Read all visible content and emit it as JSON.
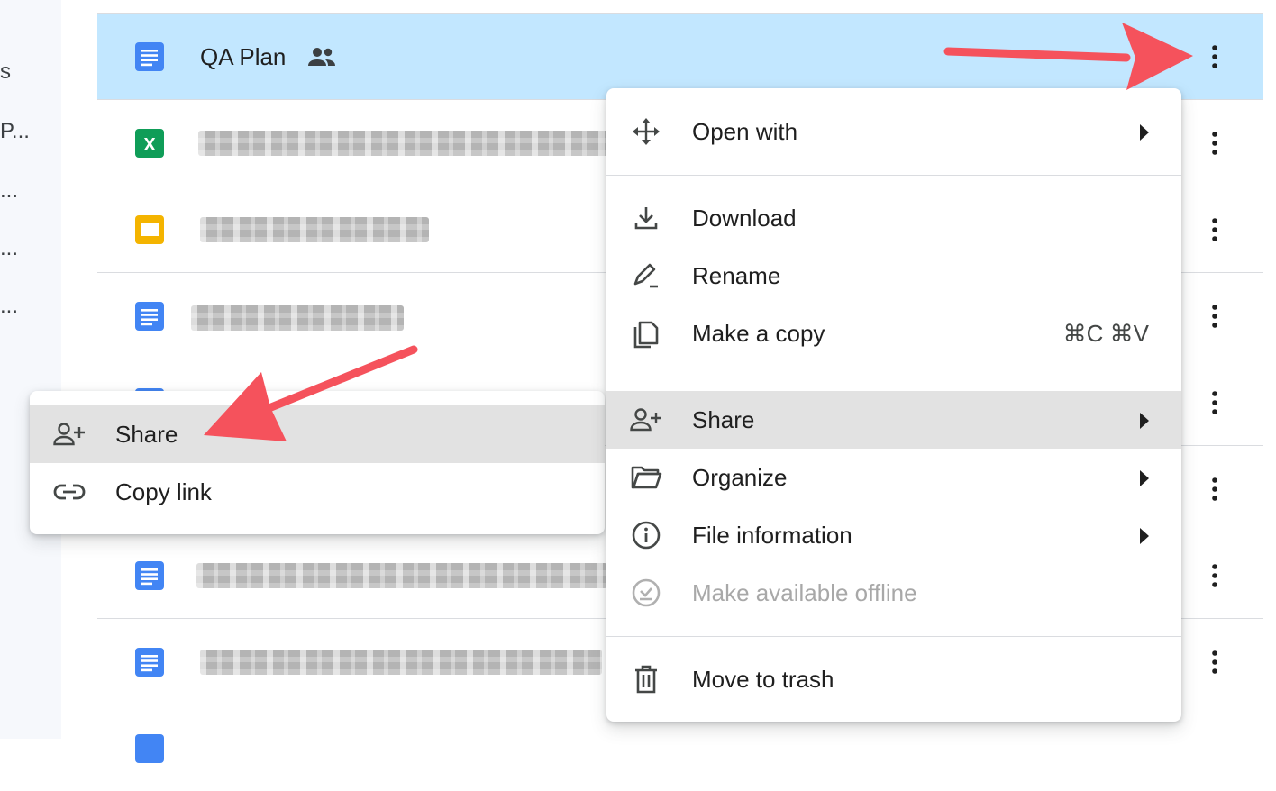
{
  "sidebar": {
    "fragments": [
      "s",
      "P...",
      "...",
      "...",
      "..."
    ]
  },
  "files": [
    {
      "name": "QA Plan",
      "type": "docs",
      "shared": true,
      "selected": true
    },
    {
      "type": "sheets",
      "blurred": true
    },
    {
      "type": "slides",
      "blurred": true
    },
    {
      "type": "docs",
      "blurred": true
    },
    {
      "type": "docs",
      "blurred": true
    },
    {
      "type": "docs",
      "blurred": true
    },
    {
      "type": "docs",
      "blurred": true
    },
    {
      "type": "docs",
      "blurred": true
    }
  ],
  "sheets_letter": "X",
  "context_menu": {
    "open_with": "Open with",
    "download": "Download",
    "rename": "Rename",
    "make_copy": "Make a copy",
    "make_copy_shortcut": "⌘C ⌘V",
    "share": "Share",
    "organize": "Organize",
    "file_information": "File information",
    "make_offline": "Make available offline",
    "move_to_trash": "Move to trash"
  },
  "share_submenu": {
    "share": "Share",
    "copy_link": "Copy link"
  },
  "colors": {
    "selected_row": "#c2e7ff",
    "docs_blue": "#4285f4",
    "sheets_green": "#0f9d58",
    "slides_yellow": "#f4b400",
    "annotation_arrow": "#f5525c",
    "menu_highlight": "#e2e2e2"
  },
  "icons": {
    "more": "more-vert-icon",
    "shared": "people-icon",
    "open_with": "move-arrows-icon",
    "download": "download-icon",
    "rename": "pencil-icon",
    "copy": "copy-icon",
    "share": "person-add-icon",
    "organize": "folder-open-icon",
    "info": "info-icon",
    "offline": "offline-check-icon",
    "trash": "trash-icon",
    "link": "link-icon"
  }
}
